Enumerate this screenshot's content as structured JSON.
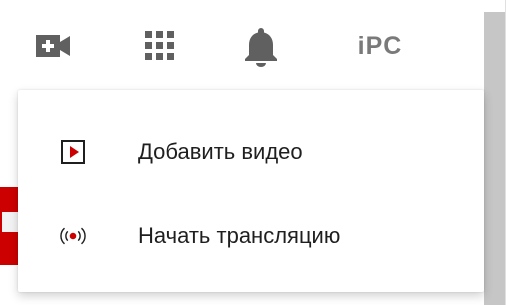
{
  "header": {
    "create_icon": "video-camera-plus-icon",
    "apps_icon": "apps-grid-icon",
    "notifications_icon": "bell-icon",
    "avatar_text": "iPC"
  },
  "menu": {
    "items": [
      {
        "label": "Добавить видео",
        "icon": "upload-video-icon",
        "icon_color": "#cc0000"
      },
      {
        "label": "Начать трансляцию",
        "icon": "live-broadcast-icon",
        "icon_color": "#cc0000"
      }
    ]
  },
  "colors": {
    "icon_gray": "#606060",
    "accent_red": "#cc0000",
    "scroll_track": "#c6c6c6",
    "avatar_dot": "#e08a2a"
  }
}
